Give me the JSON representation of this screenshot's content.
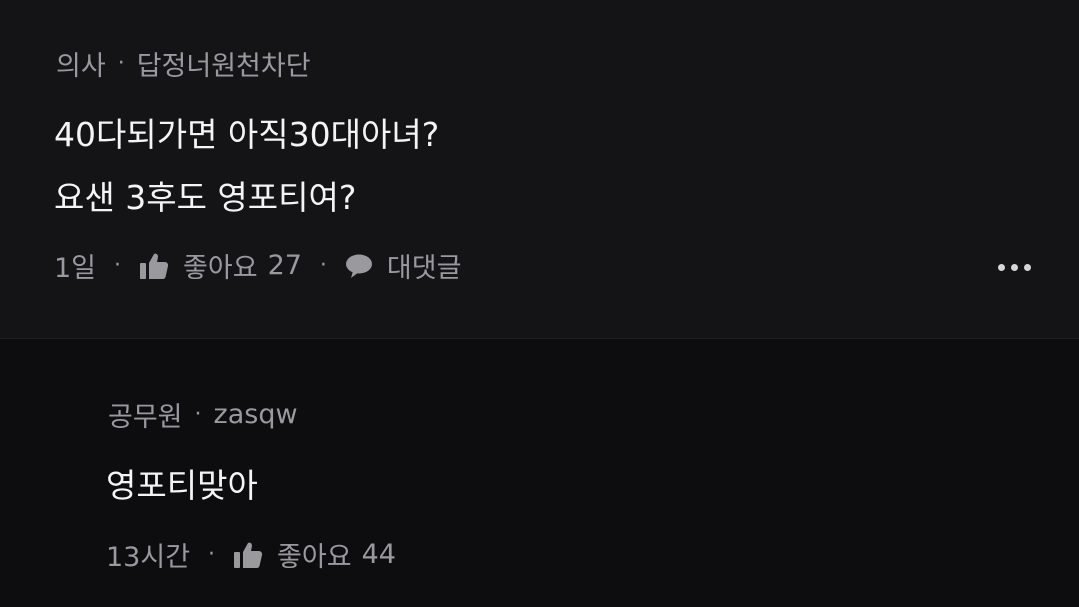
{
  "comments": [
    {
      "author_role": "의사",
      "author_name": "답정너원천차단",
      "lines": [
        "40다되가면 아직30대아녀?",
        "요샌 3후도 영포티여?"
      ],
      "time": "1일",
      "like_label": "좋아요",
      "like_count": "27",
      "reply_label": "대댓글"
    },
    {
      "author_role": "공무원",
      "author_name": "zasqw",
      "lines": [
        "영포티맞아"
      ],
      "time": "13시간",
      "like_label": "좋아요",
      "like_count": "44"
    }
  ],
  "separator": "·",
  "icons": {
    "like": "thumbs-up-icon",
    "reply": "speech-bubble-icon",
    "more": "more-options-icon"
  },
  "colors": {
    "background": "#0d0d0f",
    "comment_background": "#141416",
    "text": "#f4f4f6",
    "meta_text": "#9a9a9e"
  }
}
